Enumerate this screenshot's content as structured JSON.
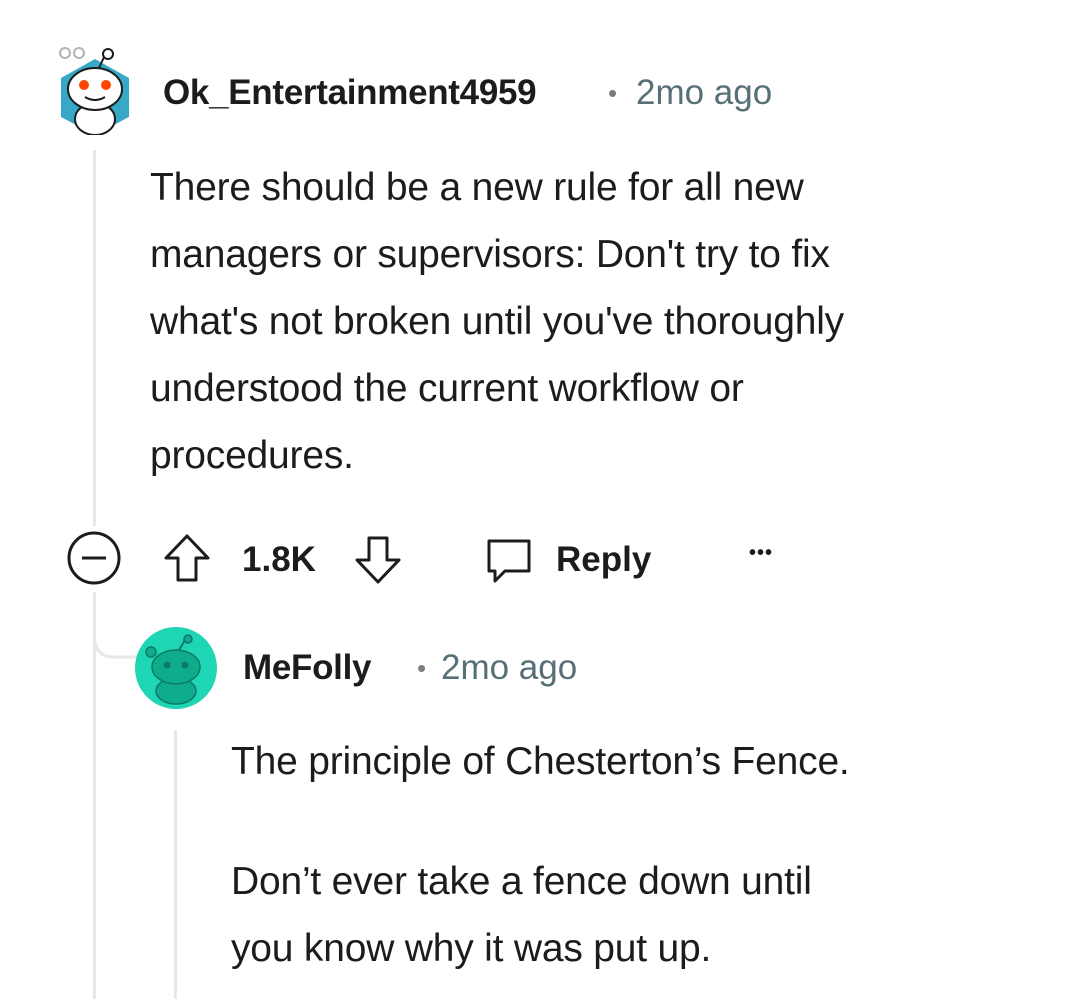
{
  "comment": {
    "author": "Ok_Entertainment4959",
    "separator": "•",
    "time": "2mo ago",
    "body_lines": [
      "There should be a new rule for all new",
      "managers or supervisors: Don't try to fix",
      "what's not broken until you've thoroughly",
      "understood the current workflow or",
      "procedures."
    ],
    "votes": "1.8K",
    "reply_label": "Reply",
    "more_label": "•••",
    "avatar": "snoo-avatar-white-icon"
  },
  "reply": {
    "author": "MeFolly",
    "separator": "•",
    "time": "2mo ago",
    "paragraphs": [
      [
        "The principle of Chesterton’s Fence."
      ],
      [
        "Don’t ever take a fence down until",
        "you know why it was put up."
      ]
    ],
    "avatar": "snoo-avatar-teal-icon",
    "avatar_color": "#1ed6b3"
  },
  "colors": {
    "text": "#1c1c1c",
    "meta": "#576f76",
    "thread_line": "#e5e7e9"
  }
}
